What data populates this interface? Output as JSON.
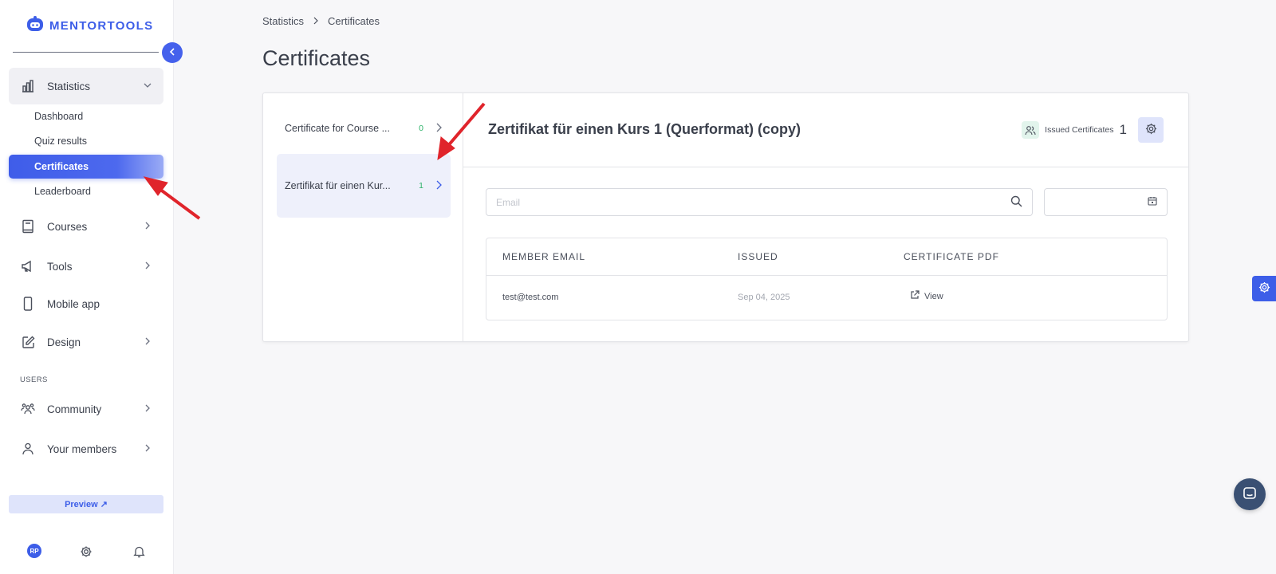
{
  "app": {
    "brand": "MENTORTOOLS"
  },
  "sidebar": {
    "groups": {
      "statistics": "Statistics",
      "courses": "Courses",
      "tools": "Tools",
      "mobile_app": "Mobile app",
      "design": "Design",
      "community": "Community",
      "your_members": "Your members"
    },
    "statistics_items": {
      "dashboard": "Dashboard",
      "quiz_results": "Quiz results",
      "certificates": "Certificates",
      "leaderboard": "Leaderboard"
    },
    "users_section": "USERS",
    "preview": "Preview ↗",
    "avatar_initials": "RP"
  },
  "breadcrumb": {
    "items": [
      "Statistics",
      "Certificates"
    ]
  },
  "page": {
    "title": "Certificates"
  },
  "certificates": [
    {
      "name": "Certificate for Course ...",
      "count": "0"
    },
    {
      "name": "Zertifikat für einen Kur...",
      "count": "1"
    }
  ],
  "detail": {
    "title": "Zertifikat für einen Kurs 1 (Querformat) (copy)",
    "issued_label": "Issued Certificates",
    "issued_count": "1",
    "email_placeholder": "Email",
    "table": {
      "headers": [
        "MEMBER EMAIL",
        "ISSUED",
        "CERTIFICATE PDF"
      ],
      "rows": [
        {
          "email": "test@test.com",
          "issued": "Sep 04, 2025",
          "pdf": "View"
        }
      ]
    }
  },
  "colors": {
    "accent": "#3d5ee8",
    "count_green": "#2fb36a",
    "annotation_arrow": "#e0242b"
  }
}
